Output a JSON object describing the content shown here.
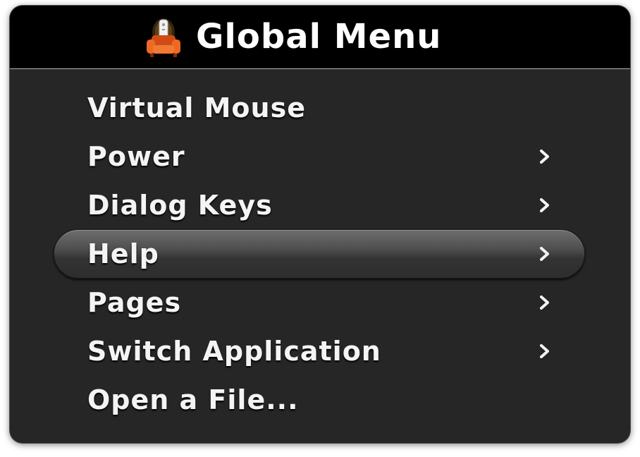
{
  "window": {
    "title": "Global Menu",
    "app_icon": "armchair-remote-icon"
  },
  "menu": {
    "selected_index": 3,
    "items": [
      {
        "label": "Virtual Mouse",
        "has_submenu": false
      },
      {
        "label": "Power",
        "has_submenu": true
      },
      {
        "label": "Dialog Keys",
        "has_submenu": true
      },
      {
        "label": "Help",
        "has_submenu": true
      },
      {
        "label": "Pages",
        "has_submenu": true
      },
      {
        "label": "Switch Application",
        "has_submenu": true
      },
      {
        "label": "Open a File...",
        "has_submenu": false
      }
    ]
  },
  "colors": {
    "background": "#262626",
    "title_bar": "#000000",
    "text": "#f4f4f4",
    "icon_orange": "#e8581c"
  }
}
